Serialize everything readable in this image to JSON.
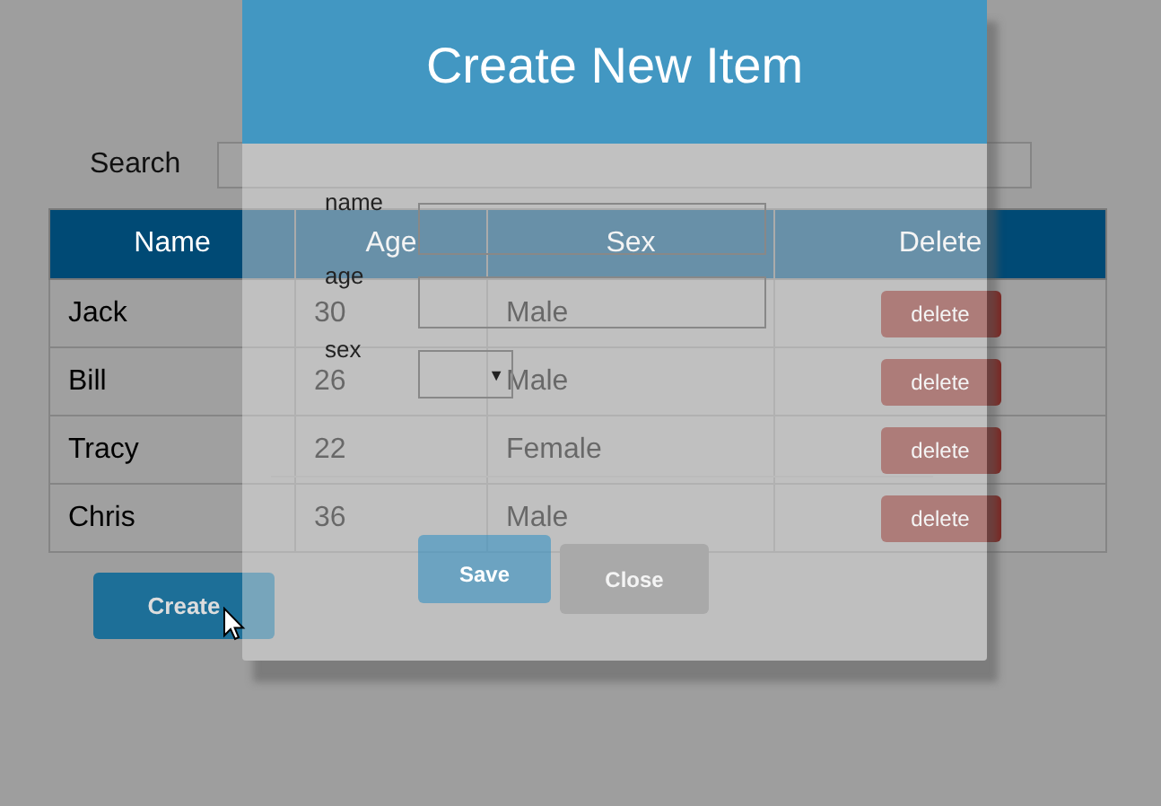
{
  "search": {
    "label": "Search"
  },
  "table": {
    "columns": [
      "Name",
      "Age",
      "Sex",
      "Delete"
    ],
    "rows": [
      {
        "name": "Jack",
        "age": "30",
        "sex": "Male",
        "action": "delete"
      },
      {
        "name": "Bill",
        "age": "26",
        "sex": "Male",
        "action": "delete"
      },
      {
        "name": "Tracy",
        "age": "22",
        "sex": "Female",
        "action": "delete"
      },
      {
        "name": "Chris",
        "age": "36",
        "sex": "Male",
        "action": "delete"
      }
    ]
  },
  "create_button": {
    "label": "Create"
  },
  "dialog": {
    "title": "Create New Item",
    "fields": [
      {
        "label": "name",
        "kind": "input"
      },
      {
        "label": "age",
        "kind": "input"
      },
      {
        "label": "sex",
        "kind": "select",
        "arrow": "▼"
      }
    ],
    "buttons": [
      {
        "label": "Save",
        "kind": "primary"
      },
      {
        "label": "Close",
        "kind": "secondary"
      }
    ]
  }
}
